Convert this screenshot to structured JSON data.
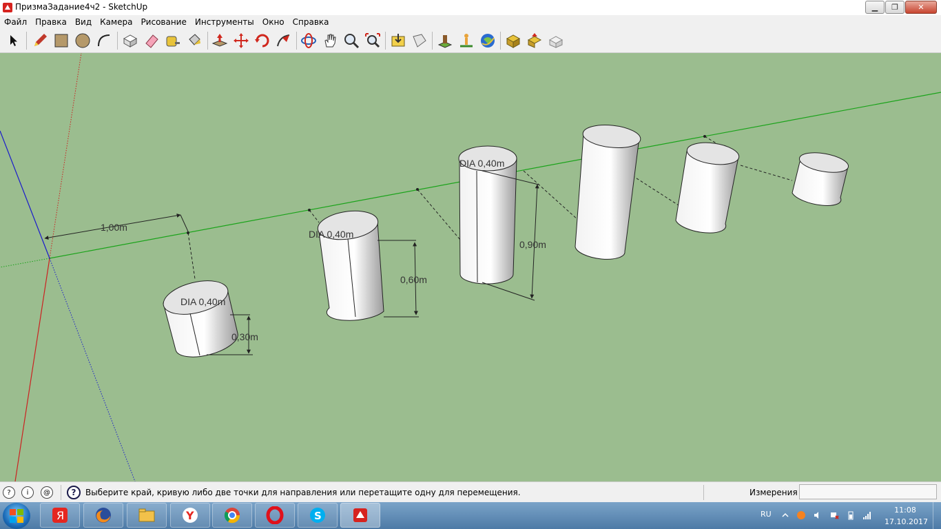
{
  "window": {
    "title": "ПризмаЗадание4ч2 - SketchUp",
    "minimize_symbol": "▁",
    "maximize_symbol": "❐",
    "close_symbol": "✕"
  },
  "menu": [
    "Файл",
    "Правка",
    "Вид",
    "Камера",
    "Рисование",
    "Инструменты",
    "Окно",
    "Справка"
  ],
  "toolbar_icons": [
    "select-icon",
    "pencil-icon",
    "rectangle-icon",
    "circle-icon",
    "arc-icon",
    "make-component-icon",
    "eraser-icon",
    "tape-measure-icon",
    "paint-bucket-icon",
    "push-pull-icon",
    "move-icon",
    "rotate-icon",
    "follow-me-icon",
    "orbit-icon",
    "pan-icon",
    "zoom-icon",
    "zoom-extents-icon",
    "get-models-icon",
    "share-model-icon",
    "add-location-icon",
    "toggle-terrain-icon",
    "google-earth-icon",
    "get-models-warehouse-icon",
    "share-component-icon",
    "extension-icon"
  ],
  "scene": {
    "dimensions": {
      "spacing": "1,00m",
      "diameter": "DIA 0,40m",
      "heights": [
        "0,30m",
        "0,60m",
        "0,90m"
      ]
    },
    "colors": {
      "background": "#9bbd8f",
      "green_axis": "#1aa31a",
      "red_axis": "#cc2020",
      "blue_axis": "#1a1acc"
    }
  },
  "status": {
    "hint": "Выберите край, кривую либо две точки для направления или перетащите одну для перемещения.",
    "measure_label": "Измерения",
    "measure_value": ""
  },
  "taskbar": {
    "apps": [
      "yandex-browser-icon",
      "firefox-icon",
      "file-explorer-icon",
      "yandex-icon",
      "chrome-icon",
      "opera-icon",
      "skype-icon",
      "sketchup-icon"
    ],
    "lang": "RU",
    "time": "11:08",
    "date": "17.10.2017"
  }
}
